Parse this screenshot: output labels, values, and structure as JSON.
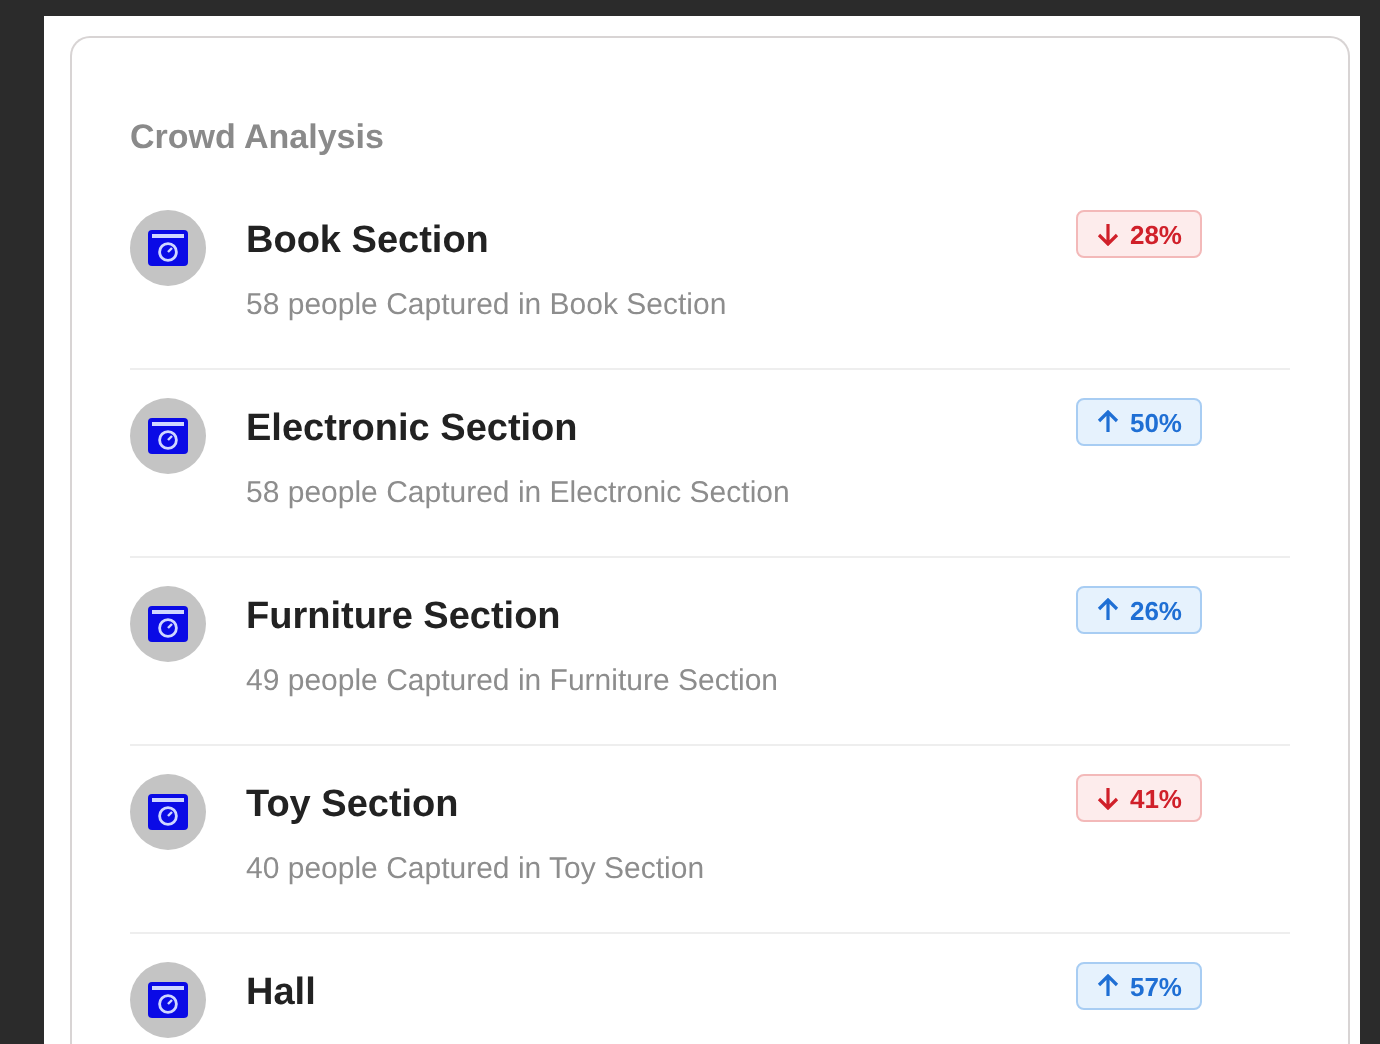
{
  "card": {
    "title": "Crowd Analysis",
    "sections": [
      {
        "name": "Book Section",
        "caption": "58 people Captured in Book Section",
        "kind": "down",
        "change": "28%"
      },
      {
        "name": "Electronic Section",
        "caption": "58 people Captured in Electronic Section",
        "kind": "up",
        "change": "50%"
      },
      {
        "name": "Furniture Section",
        "caption": "49 people Captured in Furniture Section",
        "kind": "up",
        "change": "26%"
      },
      {
        "name": "Toy Section",
        "caption": "40 people Captured in Toy Section",
        "kind": "down",
        "change": "41%"
      },
      {
        "name": "Hall",
        "kind": "up",
        "change": "57%"
      }
    ]
  }
}
